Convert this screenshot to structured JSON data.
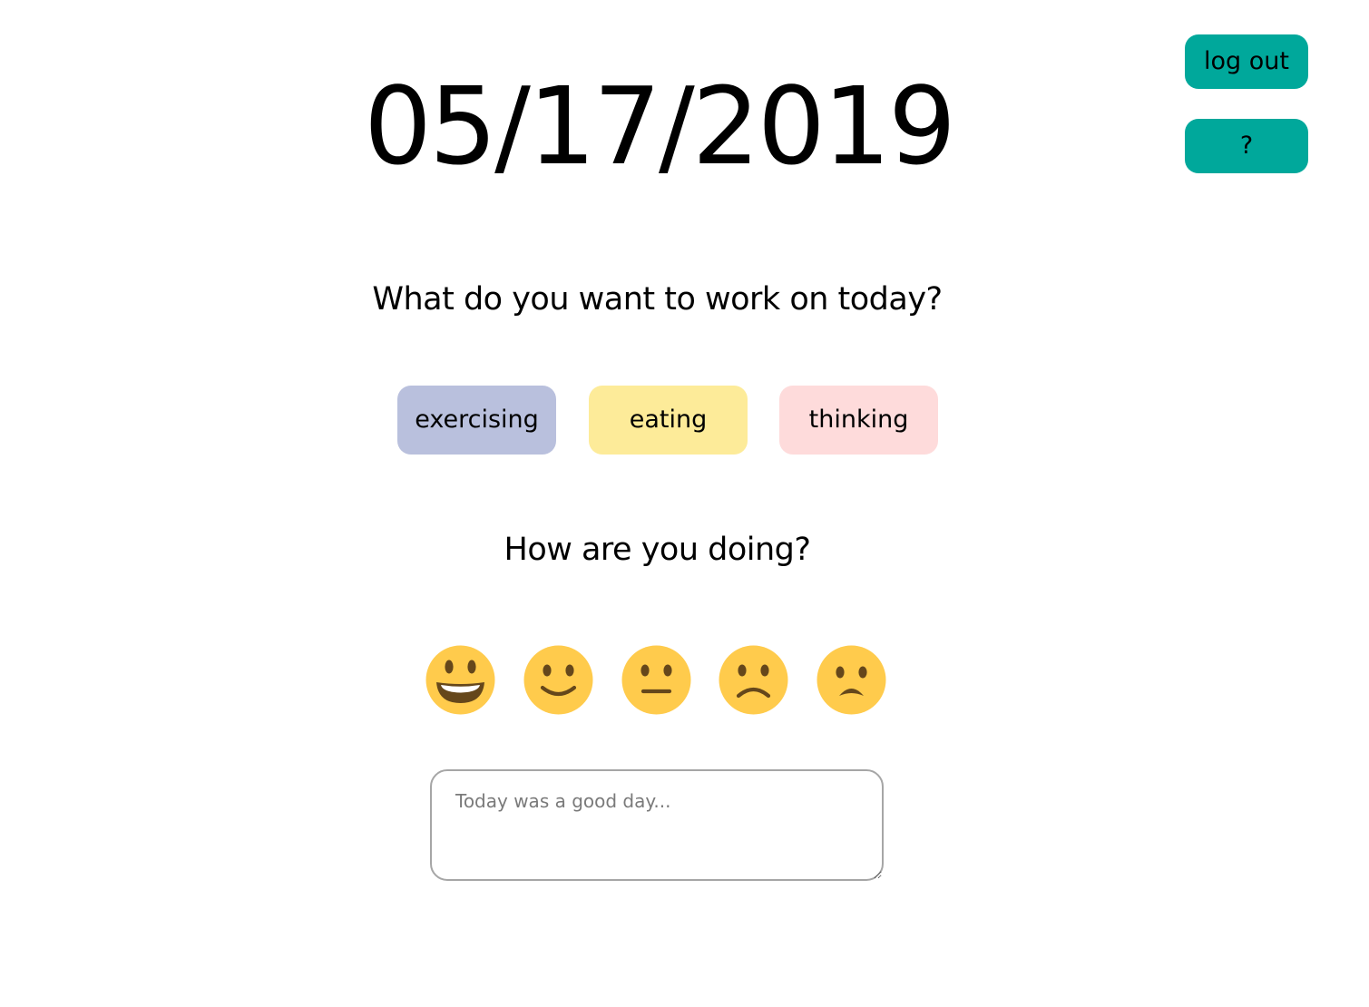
{
  "header": {
    "date": "05/17/2019",
    "logout_label": "log out",
    "help_label": "?"
  },
  "goals": {
    "question": "What do you want to work on today?",
    "options": [
      {
        "label": "exercising",
        "color": "#b9c0dd"
      },
      {
        "label": "eating",
        "color": "#fdeb99"
      },
      {
        "label": "thinking",
        "color": "#fedbdb"
      }
    ]
  },
  "mood": {
    "question": "How are you doing?",
    "options": [
      {
        "icon": "grinning-face-icon"
      },
      {
        "icon": "slightly-smiling-face-icon"
      },
      {
        "icon": "neutral-face-icon"
      },
      {
        "icon": "slightly-frowning-face-icon"
      },
      {
        "icon": "frowning-face-icon"
      }
    ],
    "face_color": "#ffcb4c",
    "feature_color": "#65471b"
  },
  "note": {
    "placeholder": "Today was a good day..."
  },
  "colors": {
    "accent": "#00a89b"
  }
}
